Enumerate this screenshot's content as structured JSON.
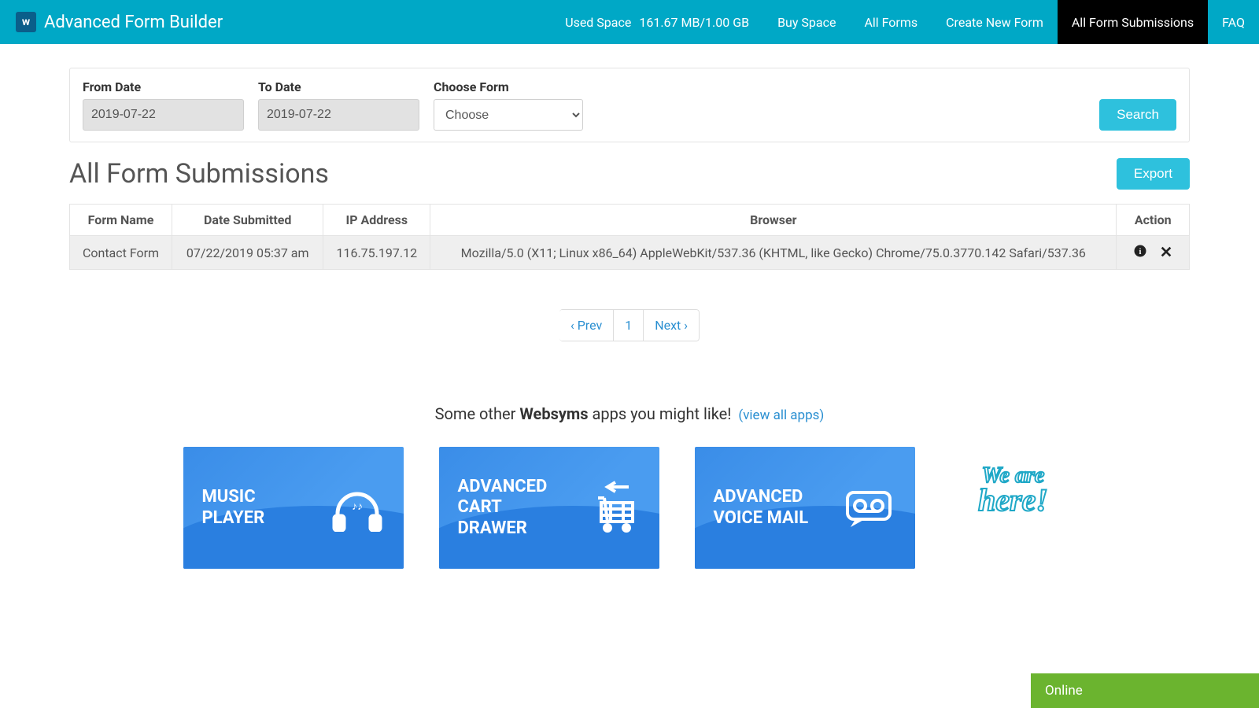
{
  "topbar": {
    "brand": "Advanced Form Builder",
    "brand_logo_letter": "w",
    "used_space_label": "Used Space",
    "used_space_value": "161.67 MB/1.00 GB",
    "nav": {
      "buy_space": "Buy Space",
      "all_forms": "All Forms",
      "create_form": "Create New Form",
      "all_submissions": "All Form Submissions",
      "faq": "FAQ"
    }
  },
  "filters": {
    "from_label": "From Date",
    "from_value": "2019-07-22",
    "to_label": "To Date",
    "to_value": "2019-07-22",
    "choose_form_label": "Choose Form",
    "choose_form_placeholder": "Choose",
    "search_btn": "Search"
  },
  "page_title": "All Form Submissions",
  "export_btn": "Export",
  "table": {
    "headers": {
      "form_name": "Form Name",
      "date": "Date Submitted",
      "ip": "IP Address",
      "browser": "Browser",
      "action": "Action"
    },
    "rows": [
      {
        "form_name": "Contact Form",
        "date": "07/22/2019 05:37 am",
        "ip": "116.75.197.12",
        "browser": "Mozilla/5.0 (X11; Linux x86_64) AppleWebKit/537.36 (KHTML, like Gecko) Chrome/75.0.3770.142 Safari/537.36"
      }
    ]
  },
  "pager": {
    "prev": "‹ Prev",
    "page1": "1",
    "next": "Next ›"
  },
  "promo": {
    "prefix": "Some other ",
    "strong": "Websyms",
    "suffix": " apps you might like! ",
    "view_all": "(view all apps)"
  },
  "cards": {
    "music": "MUSIC\nPLAYER",
    "cart": "ADVANCED\nCART\nDRAWER",
    "voice": "ADVANCED\nVOICE MAIL",
    "here_line1": "We are",
    "here_line2": "here!"
  },
  "chat": {
    "status": "Online"
  }
}
